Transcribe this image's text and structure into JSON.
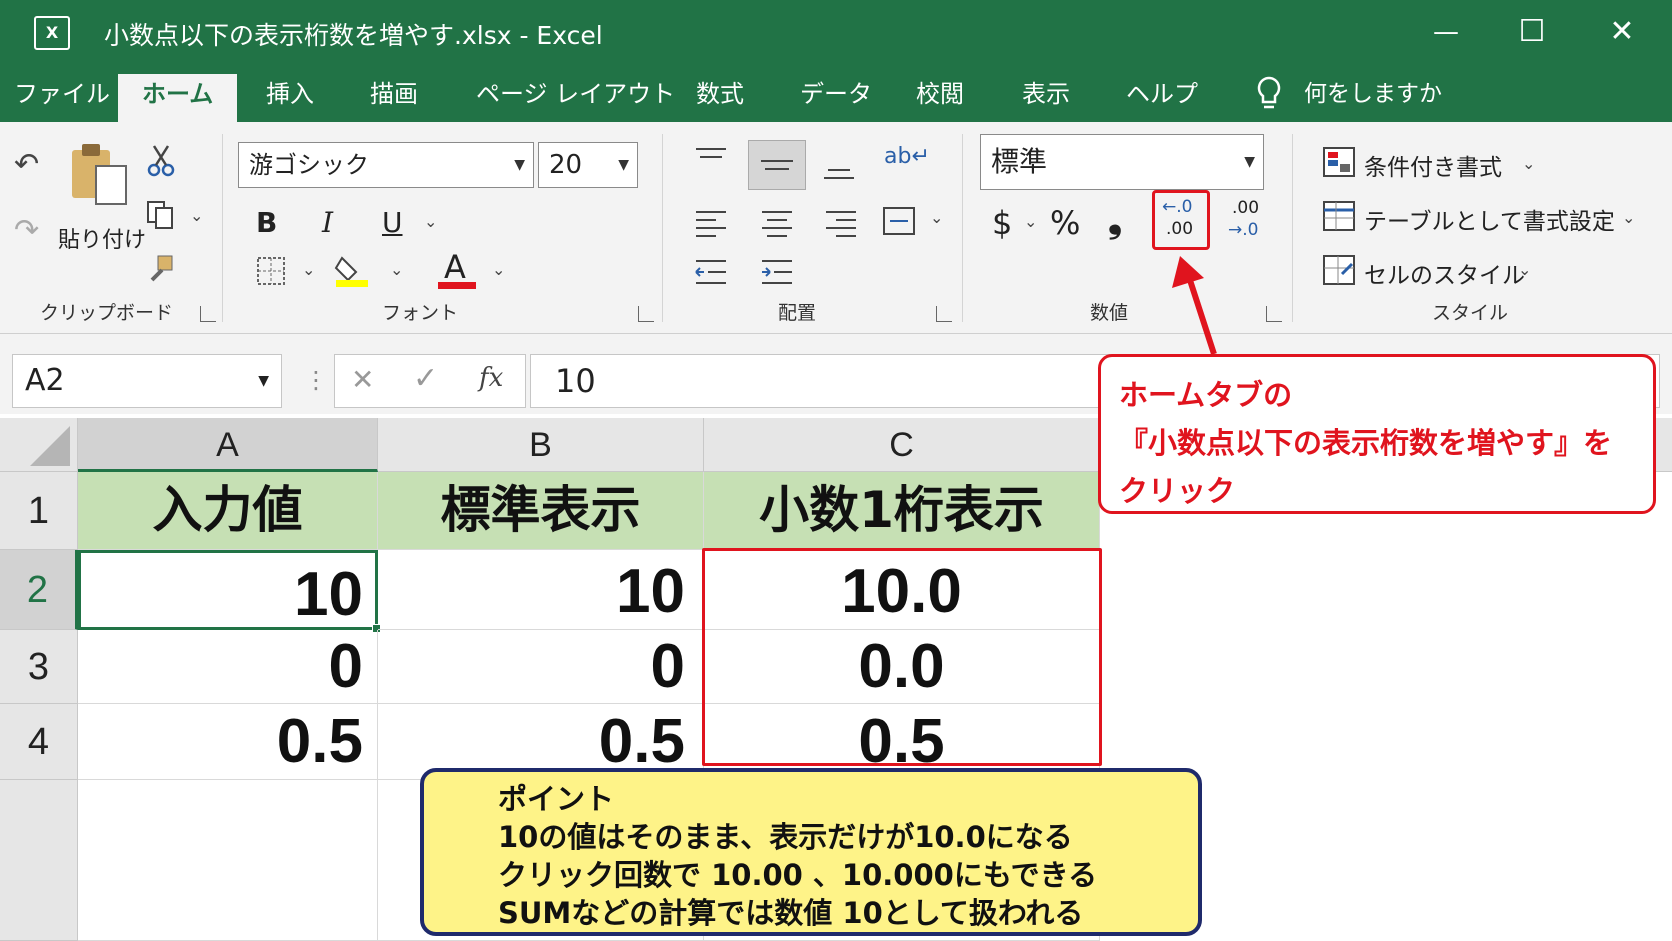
{
  "window": {
    "app_icon": "X",
    "title": "小数点以下の表示桁数を増やす.xlsx  -  Excel",
    "minimize": "—",
    "maximize": "☐",
    "close": "✕"
  },
  "tabs": [
    {
      "label": "ファイル"
    },
    {
      "label": "ホーム",
      "active": true
    },
    {
      "label": "挿入"
    },
    {
      "label": "描画"
    },
    {
      "label": "ページ レイアウト"
    },
    {
      "label": "数式"
    },
    {
      "label": "データ"
    },
    {
      "label": "校閲"
    },
    {
      "label": "表示"
    },
    {
      "label": "ヘルプ"
    }
  ],
  "tell_me": "何をしますか",
  "ribbon": {
    "clipboard": {
      "paste_label": "貼り付け",
      "group_label": "クリップボード"
    },
    "font": {
      "font_name": "游ゴシック",
      "font_size": "20",
      "bold": "B",
      "italic": "I",
      "underline": "U",
      "font_color_glyph": "A",
      "group_label": "フォント"
    },
    "alignment": {
      "group_label": "配置"
    },
    "number": {
      "format": "標準",
      "currency": "$",
      "percent": "%",
      "comma": "❟",
      "increase_decimal_top": "←.0",
      "increase_decimal_bottom": ".00",
      "decrease_decimal_top": ".00",
      "decrease_decimal_bottom": "→.0",
      "group_label": "数値"
    },
    "styles": {
      "conditional": "条件付き書式",
      "as_table": "テーブルとして書式設定",
      "cell_styles": "セルのスタイル",
      "group_label": "スタイル"
    }
  },
  "formula_bar": {
    "name_box": "A2",
    "cancel": "✕",
    "enter": "✓",
    "fx": "fx",
    "value": "10"
  },
  "sheet": {
    "columns": [
      "A",
      "B",
      "C"
    ],
    "rows": [
      "1",
      "2",
      "3",
      "4"
    ],
    "headers": [
      "入力値",
      "標準表示",
      "小数1桁表示"
    ],
    "data": [
      [
        "10",
        "10",
        "10.0"
      ],
      [
        "0",
        "0",
        "0.0"
      ],
      [
        "0.5",
        "0.5",
        "0.5"
      ]
    ],
    "header_fill": "#c6e0b4",
    "selected_cell": "A2"
  },
  "callout": {
    "lines": [
      "ホームタブの",
      "『小数点以下の表示桁数を増やす』を",
      "クリック"
    ],
    "color": "#e0141e"
  },
  "point_box": {
    "lines": [
      "ポイント",
      "10の値はそのまま、表示だけが10.0になる",
      "クリック回数で 10.00 、10.000にもできる",
      "SUMなどの計算では数値 10として扱われる"
    ],
    "fill": "#fef388"
  },
  "colors": {
    "excel_green": "#217346",
    "ribbon_bg": "#f3f3f3"
  }
}
